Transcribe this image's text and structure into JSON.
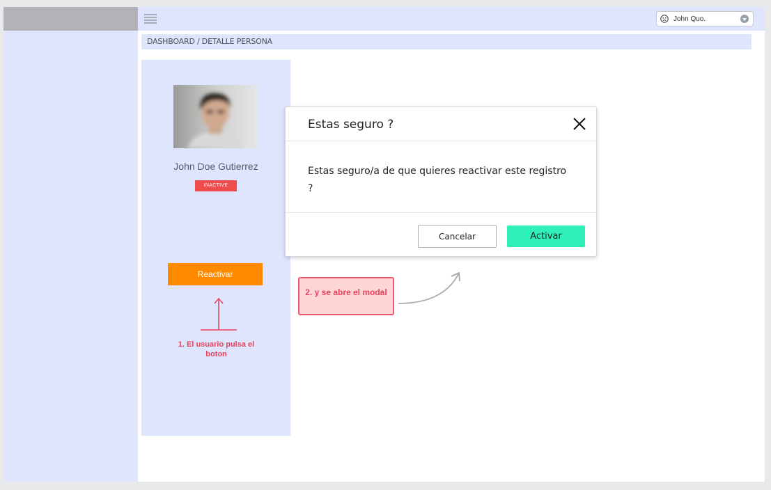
{
  "header": {
    "user_name": "John Quo.",
    "user_icon": "user-face-icon",
    "menu_icon": "hamburger-menu-icon"
  },
  "breadcrumb": "DASHBOARD / DETALLE PERSONA",
  "profile": {
    "name": "John Doe Gutierrez",
    "status": "INACTIVE",
    "action_label": "Reactivar"
  },
  "annotations": {
    "step1": "1. El usuario pulsa el boton",
    "step2": "2. y se abre el modal"
  },
  "modal": {
    "title": "Estas seguro ?",
    "message": "Estas seguro/a de que quieres reactivar este registro ?",
    "cancel_label": "Cancelar",
    "confirm_label": "Activar"
  },
  "colors": {
    "panel_bg": "#dee5fc",
    "reactivar": "#ff8a00",
    "activar": "#2ff0b9",
    "badge": "#ef4d4d",
    "annotation": "#e8415b"
  }
}
